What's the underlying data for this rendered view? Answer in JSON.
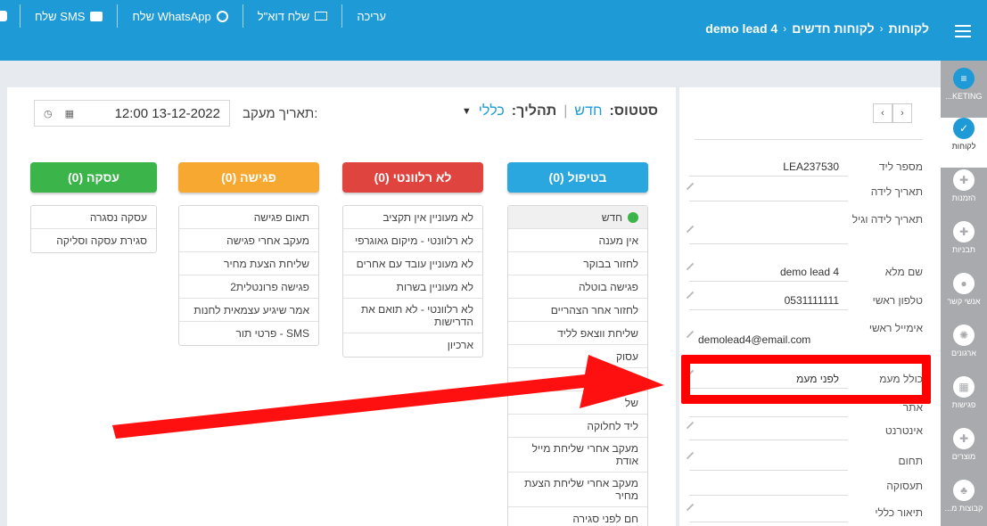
{
  "topbar": {
    "breadcrumb": [
      "לקוחות",
      "לקוחות חדשים",
      "demo lead 4"
    ],
    "actions": [
      {
        "label": "שלח SMS",
        "icon": "sms-icon"
      },
      {
        "label": "שלח WhatsApp",
        "icon": "whatsapp-icon"
      },
      {
        "label": "שלח דוא\"ל",
        "icon": "mail-icon"
      },
      {
        "label": "עריכה",
        "icon": ""
      }
    ]
  },
  "status": {
    "status_label": "סטטוס:",
    "status_value": "חדש",
    "process_label": "תהליך:",
    "process_value": "כללי"
  },
  "followup": {
    "label": "תאריך מעקב:",
    "value": "12:00 13-12-2022"
  },
  "columns": [
    {
      "title": "בטיפול (0)",
      "color": "#2aa7df",
      "items": [
        "חדש",
        "אין מענה",
        "לחזור בבוקר",
        "פגישה בוטלה",
        "לחזור אחר הצהריים",
        "שליחת ווצאפ לליד",
        "עסוק",
        "",
        "של",
        "ליד לחלוקה",
        "מעקב אחרי שליחת מייל אודת",
        "מעקב אחרי שליחת הצעת מחיר",
        "חם לפני סגירה"
      ]
    },
    {
      "title": "לא רלוונטי (0)",
      "color": "#e0443f",
      "items": [
        "לא מעוניין אין תקציב",
        "לא רלוונטי - מיקום גאוגרפי",
        "לא מעוניין עובד עם אחרים",
        "לא מעוניין בשרות",
        "לא רלוונטי - לא תואם את הדרישות",
        "ארכיון"
      ]
    },
    {
      "title": "פגישה (0)",
      "color": "#f7a830",
      "items": [
        "תאום פגישה",
        "מעקב אחרי פגישה",
        "שליחת הצעת מחיר",
        "פגישה פרונטלית2",
        "אמר שיגיע עצמאית לחנות",
        "SMS - פרטי תור"
      ]
    },
    {
      "title": "עסקה (0)",
      "color": "#3bb54a",
      "items": [
        "עסקה נסגרה",
        "סגירת עסקה וסליקה"
      ]
    }
  ],
  "lead": {
    "fields": [
      {
        "label": "מספר ליד",
        "value": "LEA237530"
      },
      {
        "label": "תאריך לידה",
        "value": ""
      },
      {
        "label": "תאריך לידה וגיל",
        "value": ""
      },
      {
        "label": "שם מלא",
        "value": "demo lead 4"
      },
      {
        "label": "טלפון ראשי",
        "value": "0531111111"
      },
      {
        "label": "אימייל ראשי",
        "value": "demolead4@email.com"
      },
      {
        "label": "כולל מעמ",
        "value": "לפני מעמ"
      },
      {
        "label": "אתר",
        "value": ""
      },
      {
        "label": "אינטרנט",
        "value": ""
      },
      {
        "label": "תחום",
        "value": ""
      },
      {
        "label": "תעסוקה",
        "value": ""
      },
      {
        "label": "תיאור כללי",
        "value": ""
      }
    ]
  },
  "sidenav": [
    {
      "label": "KETING...",
      "icon": "menu-icon"
    },
    {
      "label": "לקוחות",
      "icon": "check-icon"
    },
    {
      "label": "הזמנות",
      "icon": "puzzle-icon"
    },
    {
      "label": "תבניות",
      "icon": "puzzle-icon"
    },
    {
      "label": "אנשי קשר",
      "icon": "person-icon"
    },
    {
      "label": "ארגונים",
      "icon": "group-icon"
    },
    {
      "label": "פגישות",
      "icon": "calendar-icon"
    },
    {
      "label": "מוצרים",
      "icon": "puzzle-icon"
    },
    {
      "label": "קבוצות מ...",
      "icon": "org-chart-icon"
    }
  ]
}
